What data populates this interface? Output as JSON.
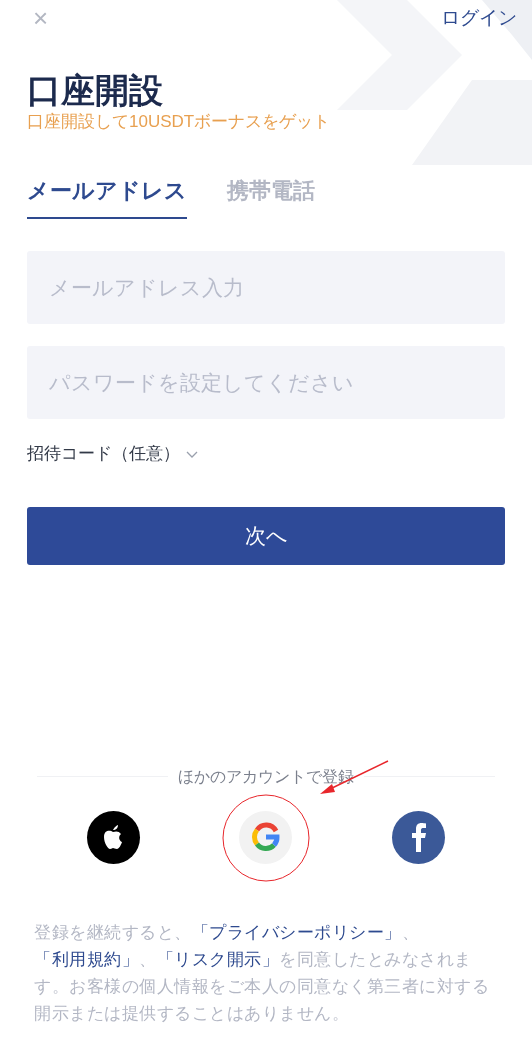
{
  "header": {
    "close": "×",
    "login": "ログイン"
  },
  "title": "口座開設",
  "subtitle": "口座開設して10USDTボーナスをゲット",
  "tabs": [
    {
      "label": "メールアドレス",
      "selected": true
    },
    {
      "label": "携帯電話",
      "selected": false
    }
  ],
  "fields": [
    {
      "placeholder": "メールアドレス入力"
    },
    {
      "placeholder": "パスワードを設定してください"
    }
  ],
  "invite_code": {
    "label": "招待コード（任意）",
    "expanded": false
  },
  "next_button": "次へ",
  "other_accounts": {
    "label": "ほかのアカウントで登録",
    "buttons": [
      {
        "kind": "apple",
        "highlighted": false
      },
      {
        "kind": "google",
        "highlighted": true
      },
      {
        "kind": "facebook",
        "highlighted": false
      }
    ]
  },
  "legal": [
    {
      "text": "登録を継続すると、",
      "link": false
    },
    {
      "text": "「プライバシーポリシー」",
      "link": true
    },
    {
      "text": "、",
      "link": false
    },
    {
      "text": "「利用規約」",
      "link": true
    },
    {
      "text": "、",
      "link": false
    },
    {
      "text": "「リスク開示」",
      "link": true
    },
    {
      "text": "を同意したとみなされます。お客様の個人情報をご本人の同意なく第三者に対する開示または提供することはありません。",
      "link": false
    }
  ]
}
